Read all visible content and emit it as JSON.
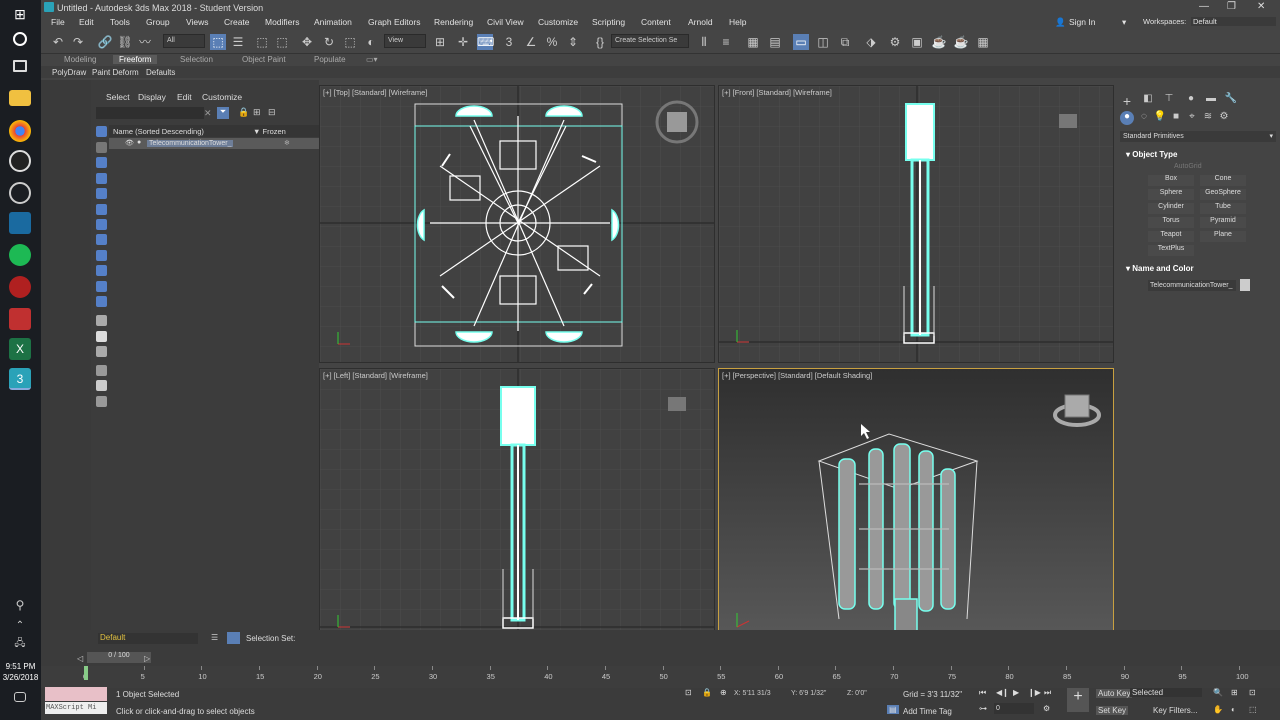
{
  "window": {
    "title": "Untitled - Autodesk 3ds Max 2018 - Student Version"
  },
  "menus": [
    "File",
    "Edit",
    "Tools",
    "Group",
    "Views",
    "Create",
    "Modifiers",
    "Animation",
    "Graph Editors",
    "Rendering",
    "Civil View",
    "Customize",
    "Scripting",
    "Content",
    "Arnold",
    "Help"
  ],
  "user": {
    "signin": "Sign In",
    "workspace_label": "Workspaces:",
    "workspace_value": "Default"
  },
  "toolbar": {
    "filter": "All",
    "refcoord": "View",
    "selset": "Create Selection Se"
  },
  "ribbon": {
    "tabs": [
      "Modeling",
      "Freeform",
      "Selection",
      "Object Paint",
      "Populate"
    ],
    "active": "Freeform"
  },
  "subribbon": [
    "PolyDraw",
    "Paint Deform",
    "Defaults"
  ],
  "scene_explorer": {
    "menus": [
      "Select",
      "Display",
      "Edit",
      "Customize"
    ],
    "col_name": "Name (Sorted Descending)",
    "col_frozen": "Frozen",
    "item": "TelecommunicationTower_"
  },
  "viewports": {
    "top": "[+] [Top] [Standard] [Wireframe]",
    "front": "[+] [Front] [Standard] [Wireframe]",
    "left": "[+] [Left] [Standard] [Wireframe]",
    "persp": "[+] [Perspective] [Standard] [Default Shading]"
  },
  "command_panel": {
    "category": "Standard Primitives",
    "object_type": "Object Type",
    "autogrid": "AutoGrid",
    "buttons": [
      "Box",
      "Cone",
      "Sphere",
      "GeoSphere",
      "Cylinder",
      "Tube",
      "Torus",
      "Pyramid",
      "Teapot",
      "Plane",
      "TextPlus"
    ],
    "name_color": "Name and Color",
    "name_value": "TelecommunicationTower_"
  },
  "bottom": {
    "layer": "Default",
    "selection_set": "Selection Set:",
    "frame_range": "0 / 100",
    "ticks": [
      "0",
      "5",
      "10",
      "15",
      "20",
      "25",
      "30",
      "35",
      "40",
      "45",
      "50",
      "55",
      "60",
      "65",
      "70",
      "75",
      "80",
      "85",
      "90",
      "95",
      "100"
    ],
    "maxscript": "MAXScript Mi",
    "status1": "1 Object Selected",
    "status2": "Click or click-and-drag to select objects",
    "x": "X: 5'11 31/3",
    "y": "Y: 6'9 1/32\"",
    "z": "Z: 0'0\"",
    "grid": "Grid = 3'3 11/32\"",
    "add_time_tag": "Add Time Tag",
    "autokey": "Auto Key",
    "setkey": "Set Key",
    "selected": "Selected",
    "key_filters": "Key Filters...",
    "frame": "0"
  },
  "taskbar": {
    "time": "9:51 PM",
    "date": "3/26/2018"
  }
}
